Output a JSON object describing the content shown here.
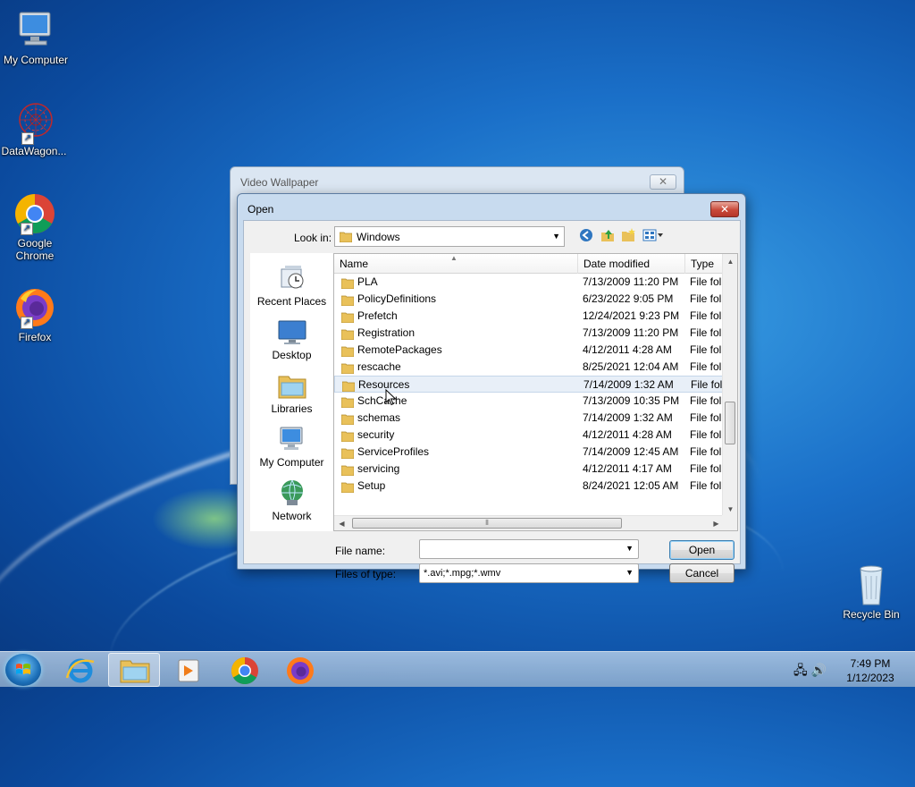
{
  "desktop": {
    "icons": [
      {
        "label": "My Computer",
        "icon": "computer-icon"
      },
      {
        "label": "DataWagon...",
        "icon": "datawagon-icon"
      },
      {
        "label": "Google Chrome",
        "icon": "chrome-icon"
      },
      {
        "label": "Firefox",
        "icon": "firefox-icon"
      },
      {
        "label": "Recycle Bin",
        "icon": "recycle-bin-icon"
      }
    ]
  },
  "bg_window": {
    "title": "Video Wallpaper",
    "close": "✕"
  },
  "dialog": {
    "title": "Open",
    "close": "✕",
    "look_in_label": "Look in:",
    "look_in_value": "Windows",
    "places": [
      {
        "label": "Recent Places",
        "icon": "recent-places-icon"
      },
      {
        "label": "Desktop",
        "icon": "desktop-icon"
      },
      {
        "label": "Libraries",
        "icon": "libraries-icon"
      },
      {
        "label": "My Computer",
        "icon": "computer-icon"
      },
      {
        "label": "Network",
        "icon": "network-icon"
      }
    ],
    "columns": {
      "name": "Name",
      "date": "Date modified",
      "type": "Type"
    },
    "files": [
      {
        "name": "PLA",
        "date": "7/13/2009 11:20 PM",
        "type": "File fol"
      },
      {
        "name": "PolicyDefinitions",
        "date": "6/23/2022 9:05 PM",
        "type": "File fol"
      },
      {
        "name": "Prefetch",
        "date": "12/24/2021 9:23 PM",
        "type": "File fol"
      },
      {
        "name": "Registration",
        "date": "7/13/2009 11:20 PM",
        "type": "File fol"
      },
      {
        "name": "RemotePackages",
        "date": "4/12/2011 4:28 AM",
        "type": "File fol"
      },
      {
        "name": "rescache",
        "date": "8/25/2021 12:04 AM",
        "type": "File fol"
      },
      {
        "name": "Resources",
        "date": "7/14/2009 1:32 AM",
        "type": "File fol"
      },
      {
        "name": "SchCache",
        "date": "7/13/2009 10:35 PM",
        "type": "File fol"
      },
      {
        "name": "schemas",
        "date": "7/14/2009 1:32 AM",
        "type": "File fol"
      },
      {
        "name": "security",
        "date": "4/12/2011 4:28 AM",
        "type": "File fol"
      },
      {
        "name": "ServiceProfiles",
        "date": "7/14/2009 12:45 AM",
        "type": "File fol"
      },
      {
        "name": "servicing",
        "date": "4/12/2011 4:17 AM",
        "type": "File fol"
      },
      {
        "name": "Setup",
        "date": "8/24/2021 12:05 AM",
        "type": "File fol"
      }
    ],
    "hovered_index": 6,
    "file_name_label": "File name:",
    "file_name_value": "",
    "files_of_type_label": "Files of type:",
    "files_of_type_value": "*.avi;*.mpg;*.wmv",
    "open_button": "Open",
    "cancel_button": "Cancel"
  },
  "taskbar": {
    "items": [
      "start-orb",
      "internet-explorer-icon",
      "file-explorer-icon",
      "media-player-icon",
      "chrome-icon",
      "firefox-icon"
    ],
    "active": "file-explorer-icon",
    "clock_time": "7:49 PM",
    "clock_date": "1/12/2023"
  },
  "colors": {
    "accent": "#1a6fc8",
    "close_red": "#c9493a",
    "hover_row": "#e8eff8"
  }
}
